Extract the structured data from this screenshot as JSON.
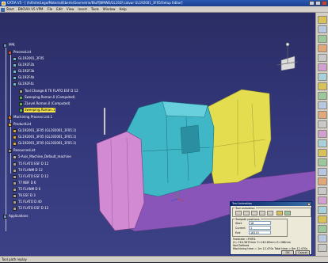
{
  "window": {
    "title": "CATIA V5 - [ /Infinite/Lego/Material/Eberle/Geometrie/Bluff]BMWE/GL192F.catvar GL192001_3F05/Setup Editor]"
  },
  "menubar": {
    "items": [
      "Start",
      "ENOVIA V5 VPM",
      "File",
      "Edit",
      "View",
      "Insert",
      "Tools",
      "Window",
      "Help"
    ]
  },
  "tree": {
    "items": [
      {
        "label": "PPR",
        "indent": 0
      },
      {
        "label": "ProcessList",
        "indent": 1
      },
      {
        "label": "GL192001_3F05",
        "indent": 2
      },
      {
        "label": "GL192F2b",
        "indent": 2
      },
      {
        "label": "GL192F3b",
        "indent": 2
      },
      {
        "label": "GL192F4b",
        "indent": 2
      },
      {
        "label": "GL192F4c",
        "indent": 2
      },
      {
        "label": "Tool Change.6 T6 FLATO ESF D 12",
        "indent": 3
      },
      {
        "label": "Sweeping.Roman.0 (Computed)",
        "indent": 3
      },
      {
        "label": "ZLevel.Roman.0 (Computed)",
        "indent": 3
      },
      {
        "label": "Sweeping.Roman.1",
        "indent": 3,
        "selected": true
      },
      {
        "label": "Machining Process List.1",
        "indent": 1
      },
      {
        "label": "ProductList",
        "indent": 1
      },
      {
        "label": "GL192001_3F05 (GL192001_3F05.1)",
        "indent": 2
      },
      {
        "label": "GL192001_3F05 (GL192001_3F05.1)",
        "indent": 2
      },
      {
        "label": "GL192001_3F05 (GL192001_3F05.1)",
        "indent": 2
      },
      {
        "label": "ResourcesList",
        "indent": 1
      },
      {
        "label": "5-Axis_Machine_Default_machine",
        "indent": 2
      },
      {
        "label": "T5 FLATO ESF D 12",
        "indent": 2
      },
      {
        "label": "T4 FLANM D 12",
        "indent": 2
      },
      {
        "label": "T3 FLATO ESF D 12",
        "indent": 2
      },
      {
        "label": "T7 NBF D 6",
        "indent": 2
      },
      {
        "label": "T5 FLANM D 6",
        "indent": 2
      },
      {
        "label": "T6 ESF D 3",
        "indent": 2
      },
      {
        "label": "T1 FLATO D 40",
        "indent": 2
      },
      {
        "label": "T2 FLATO ESF D 12",
        "indent": 2
      },
      {
        "label": "Applications",
        "indent": 0
      }
    ]
  },
  "dialog": {
    "title": "Tool Animation",
    "close": "x",
    "group_animation": "Tool animation",
    "group_positions": "Toolpath positions",
    "start_label": "Start",
    "start_value": "16",
    "current_label": "Current",
    "current_value": "1",
    "end_label": "End",
    "end_value": "16115",
    "info_1": "Feedrate =FMFD",
    "info_2": "X=-744.3679mm Y=140.85mm Z=186mm",
    "info_3": "Not Defined",
    "info_4": "Machining time = 1m 12.470s   Total time = 8m 12.470s",
    "ok": "OK",
    "cancel": "Cancel"
  },
  "statusbar": {
    "text": "Tool path replay"
  },
  "colors": {
    "viewport_top": "#2b2d64",
    "viewport_bottom": "#3c4186",
    "part_cyan": "#3fb7c6",
    "part_yellow": "#e4dd4f",
    "part_magenta": "#d28ad3",
    "plate_purple": "#8a55b8",
    "selection": "#f3e44a"
  }
}
